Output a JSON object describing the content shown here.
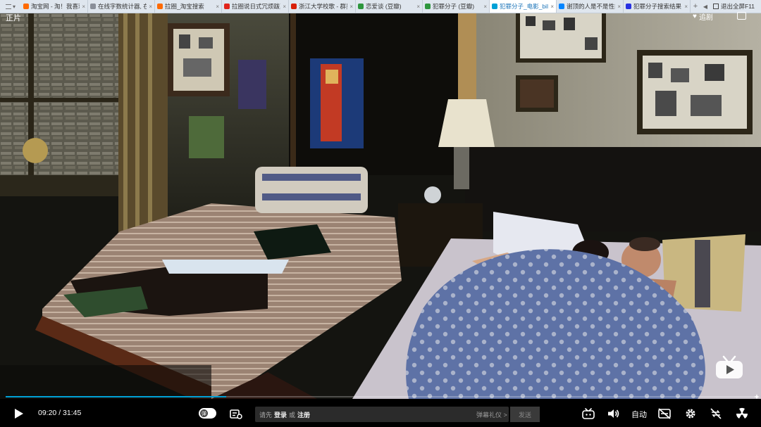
{
  "browser": {
    "tabs": [
      {
        "title": "淘宝网 - 淘！我喜欢",
        "favicon": "taobao-icon",
        "color": "#ff6a00",
        "active": false
      },
      {
        "title": "在线字数统计器, 在线",
        "favicon": "doc-icon",
        "color": "#8a8f99",
        "active": false
      },
      {
        "title": "拉圈_淘宝搜索",
        "favicon": "taobao-icon",
        "color": "#ff6a00",
        "active": false
      },
      {
        "title": "拉圈说日式冗烦跋剪",
        "favicon": "t-icon",
        "color": "#e1251b",
        "active": false
      },
      {
        "title": "浙江大学校歌 - 群星",
        "favicon": "netease-icon",
        "color": "#d81e06",
        "active": false
      },
      {
        "title": "恋爱谈 (豆瓣)",
        "favicon": "douban-icon",
        "color": "#2e963d",
        "active": false
      },
      {
        "title": "犯罪分子 (豆瓣)",
        "favicon": "douban-icon",
        "color": "#2e963d",
        "active": false
      },
      {
        "title": "犯罪分子_电影_bilibili",
        "favicon": "bilibili-icon",
        "color": "#00a1d6",
        "active": true
      },
      {
        "title": "谢顶的人是不是性能",
        "favicon": "zhihu-icon",
        "color": "#0084ff",
        "active": false
      },
      {
        "title": "犯罪分子搜索结果 -",
        "favicon": "paw-icon",
        "color": "#2932e1",
        "active": false
      }
    ],
    "tab_close": "×",
    "new_tab": "+",
    "exit_fullscreen": "退出全屏F11"
  },
  "player": {
    "episode_title": "正片",
    "follow_label": "追剧",
    "current_time": "09:20",
    "separator": "/",
    "total_time": "31:45",
    "progress": 0.294,
    "danmaku_toggle_glyph": "弹",
    "danmaku_prompt_prefix": "请先",
    "login_label": "登录",
    "or_label": "或",
    "register_label": "注册",
    "etiquette_label": "弹幕礼仪 >",
    "send_label": "发送",
    "quality_label": "自动",
    "accent_color": "#00a1d6"
  }
}
